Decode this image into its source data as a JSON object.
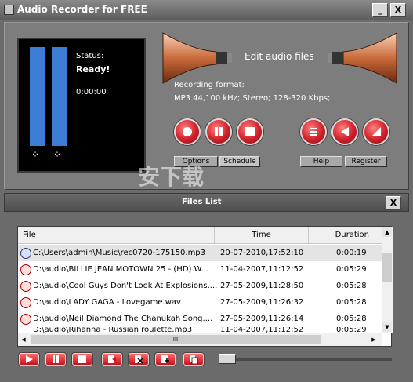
{
  "window": {
    "title": "Audio Recorder for FREE",
    "minimize_label": "_",
    "close_label": "X"
  },
  "display": {
    "status_label": "Status:",
    "status_value": "Ready!",
    "time": "0:00:00"
  },
  "editor": {
    "edit_label": "Edit audio files",
    "format_title": "Recording format:",
    "format_value": "MP3 44,100 kHz; Stereo;  128-320 Kbps;"
  },
  "buttons": {
    "options": "Options",
    "schedule": "Schedule",
    "help": "Help",
    "register": "Register"
  },
  "files_panel": {
    "title": "Files List",
    "close_label": "X"
  },
  "files_table": {
    "columns": [
      "File",
      "Time",
      "Duration"
    ],
    "rows": [
      {
        "file": "C:\\Users\\admin\\Music\\rec0720-175150.mp3",
        "time": "20-07-2010,17:52:10",
        "duration": "0:00:19"
      },
      {
        "file": "D:\\audio\\BILLIE JEAN MOTOWN 25 -  (HD) W...",
        "time": "11-04-2007,11:12:52",
        "duration": "0:05:29"
      },
      {
        "file": "D:\\audio\\Cool Guys Don't Look At Explosions....",
        "time": "27-05-2009,11:28:50",
        "duration": "0:05:28"
      },
      {
        "file": "D:\\audio\\LADY GAGA - Lovegame.wav",
        "time": "27-05-2009,11:26:32",
        "duration": "0:05:28"
      },
      {
        "file": "D:\\audio\\Neil Diamond  The Chanukah Song....",
        "time": "27-05-2009,11:26:14",
        "duration": "0:05:28"
      },
      {
        "file": "D:\\audio\\Rihanna - Russian roulette.mp3",
        "time": "11-04-2007,11:12:52",
        "duration": "0:05:29"
      }
    ],
    "hscroll_grip": "III"
  },
  "watermark": "安下载",
  "colors": {
    "accent_red": "#d0202a",
    "meter_blue": "#3d7dd6",
    "panel_gray": "#7d7d7d"
  }
}
